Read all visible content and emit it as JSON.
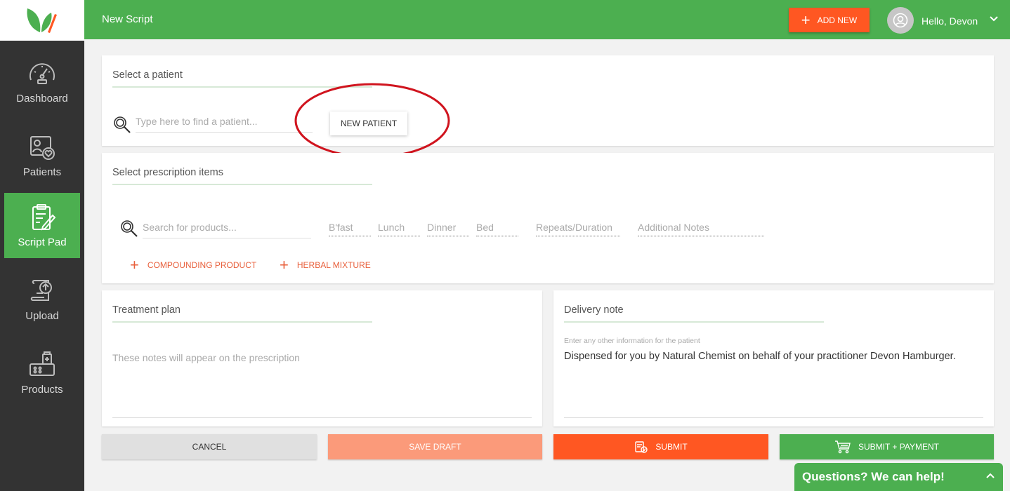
{
  "sidebar": {
    "items": [
      {
        "label": "Dashboard",
        "icon": "speedometer-icon"
      },
      {
        "label": "Patients",
        "icon": "patient-heart-icon"
      },
      {
        "label": "Script Pad",
        "icon": "clipboard-pen-icon",
        "active": true
      },
      {
        "label": "Upload",
        "icon": "upload-scroll-icon"
      },
      {
        "label": "Products",
        "icon": "products-cart-icon"
      }
    ]
  },
  "header": {
    "title": "New Script",
    "add_new": "ADD NEW",
    "user_greeting": "Hello, Devon"
  },
  "patient": {
    "title": "Select a patient",
    "search_placeholder": "Type here to find a patient...",
    "new_patient": "NEW PATIENT"
  },
  "prescription": {
    "title": "Select prescription items",
    "search_placeholder": "Search for products...",
    "columns": [
      "B'fast",
      "Lunch",
      "Dinner",
      "Bed",
      "Repeats/Duration",
      "Additional Notes"
    ],
    "compounding": "COMPOUNDING PRODUCT",
    "herbal": "HERBAL MIXTURE"
  },
  "treatment": {
    "title": "Treatment plan",
    "placeholder": "These notes will appear on the prescription"
  },
  "delivery": {
    "title": "Delivery note",
    "hint": "Enter any other information for the patient",
    "text": "Dispensed for you by Natural Chemist on behalf of your practitioner Devon Hamburger."
  },
  "actions": {
    "cancel": "CANCEL",
    "save_draft": "SAVE DRAFT",
    "submit": "SUBMIT",
    "submit_payment": "SUBMIT + PAYMENT"
  },
  "help": {
    "label": "Questions? We can help!"
  },
  "colors": {
    "brand_green": "#4caf50",
    "accent_orange": "#ff5722",
    "sidebar": "#333333",
    "annotation_red": "#d0141e"
  }
}
